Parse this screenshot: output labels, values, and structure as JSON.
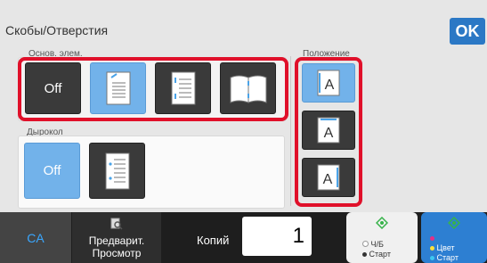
{
  "header": {
    "title": "Скобы/Отверстия",
    "ok_label": "OK"
  },
  "staple": {
    "label": "Основ. элем.",
    "options": [
      {
        "label": "Off",
        "icon": "off",
        "selected": false
      },
      {
        "label": "",
        "icon": "staple-corner-icon",
        "selected": true
      },
      {
        "label": "",
        "icon": "staple-two-left-icon",
        "selected": false
      },
      {
        "label": "",
        "icon": "staple-booklet-icon",
        "selected": false
      }
    ]
  },
  "punch": {
    "label": "Дырокол",
    "options": [
      {
        "label": "Off",
        "icon": "off",
        "selected": true
      },
      {
        "label": "",
        "icon": "punch-left-icon",
        "selected": false
      }
    ]
  },
  "position": {
    "label": "Положение",
    "options": [
      {
        "label": "A",
        "icon": "position-left-icon",
        "selected": true
      },
      {
        "label": "A",
        "icon": "position-top-icon",
        "selected": false
      },
      {
        "label": "A",
        "icon": "position-right-icon",
        "selected": false
      }
    ]
  },
  "footer": {
    "ca_label": "CA",
    "preview_label_line1": "Предварит.",
    "preview_label_line2": "Просмотр",
    "copies_label": "Копий",
    "copies_value": "1",
    "bw_start_line1": "Ч/Б",
    "bw_start_line2": "Старт",
    "color_start_line1": "Цвет",
    "color_start_line2": "Старт"
  },
  "colors": {
    "accent": "#2b78c5",
    "highlight": "#e0102a",
    "selected": "#72b2ea"
  }
}
